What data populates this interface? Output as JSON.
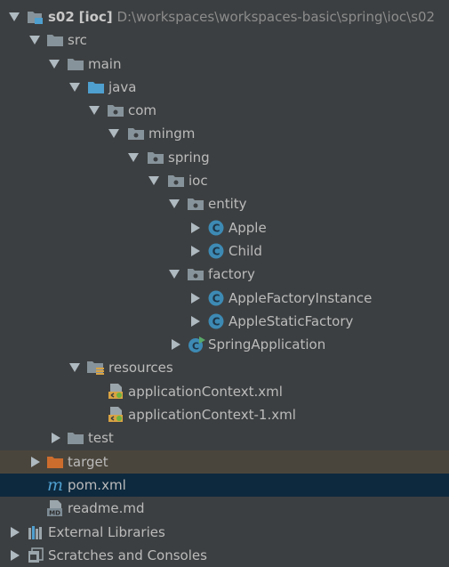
{
  "project": {
    "module_name": "s02",
    "module_tag": "[ioc]",
    "module_path": "D:\\workspaces\\workspaces-basic\\spring\\ioc\\s02"
  },
  "tree": {
    "src": "src",
    "main": "main",
    "java": "java",
    "com": "com",
    "mingm": "mingm",
    "spring": "spring",
    "ioc": "ioc",
    "entity": "entity",
    "apple": "Apple",
    "child": "Child",
    "factory": "factory",
    "apple_factory_instance": "AppleFactoryInstance",
    "apple_static_factory": "AppleStaticFactory",
    "spring_application": "SpringApplication",
    "resources": "resources",
    "app_context_xml": "applicationContext.xml",
    "app_context_1_xml": "applicationContext-1.xml",
    "test": "test",
    "target": "target",
    "pom_xml": "pom.xml",
    "readme_md": "readme.md",
    "external_libraries": "External Libraries",
    "scratches": "Scratches and Consoles"
  },
  "badges": {
    "class_badge": "C",
    "maven_glyph": "m",
    "md_badge": "MD"
  },
  "colors": {
    "background": "#3c3f41",
    "selected_row": "#0d293e",
    "excluded_row": "#4a453c",
    "folder": "#87939a",
    "source_folder": "#4f9fcf",
    "excluded_folder": "#cc6d2d",
    "class_icon": "#3d8ab4",
    "text": "#bbbbbb"
  }
}
